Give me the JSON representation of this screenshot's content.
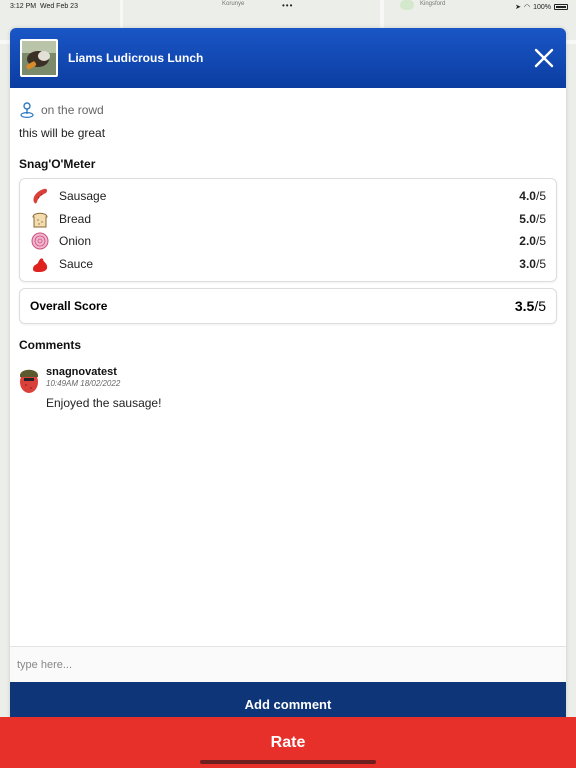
{
  "status_bar": {
    "time": "3:12 PM",
    "date": "Wed Feb 23",
    "battery": "100%"
  },
  "map_labels": [
    "Korunye",
    "Kingsford"
  ],
  "post": {
    "title": "Liams Ludicrous Lunch",
    "location": "on the rowd",
    "description": "this will be great"
  },
  "meter": {
    "heading": "Snag'O'Meter",
    "items": [
      {
        "name": "Sausage",
        "icon": "sausage-icon",
        "score": "4.0",
        "max": "/5"
      },
      {
        "name": "Bread",
        "icon": "bread-icon",
        "score": "5.0",
        "max": "/5"
      },
      {
        "name": "Onion",
        "icon": "onion-icon",
        "score": "2.0",
        "max": "/5"
      },
      {
        "name": "Sauce",
        "icon": "sauce-icon",
        "score": "3.0",
        "max": "/5"
      }
    ],
    "overall_label": "Overall Score",
    "overall_score": "3.5",
    "overall_max": "/5"
  },
  "comments": {
    "heading": "Comments",
    "list": [
      {
        "user": "snagnovatest",
        "time": "10:49AM 18/02/2022",
        "text": "Enjoyed the sausage!"
      }
    ]
  },
  "input": {
    "placeholder": "type here..."
  },
  "buttons": {
    "add_comment": "Add comment",
    "rate": "Rate"
  },
  "colors": {
    "header": "#0b3da1",
    "add_comment_bg": "#0d3577",
    "rate_bg": "#e8302a"
  }
}
